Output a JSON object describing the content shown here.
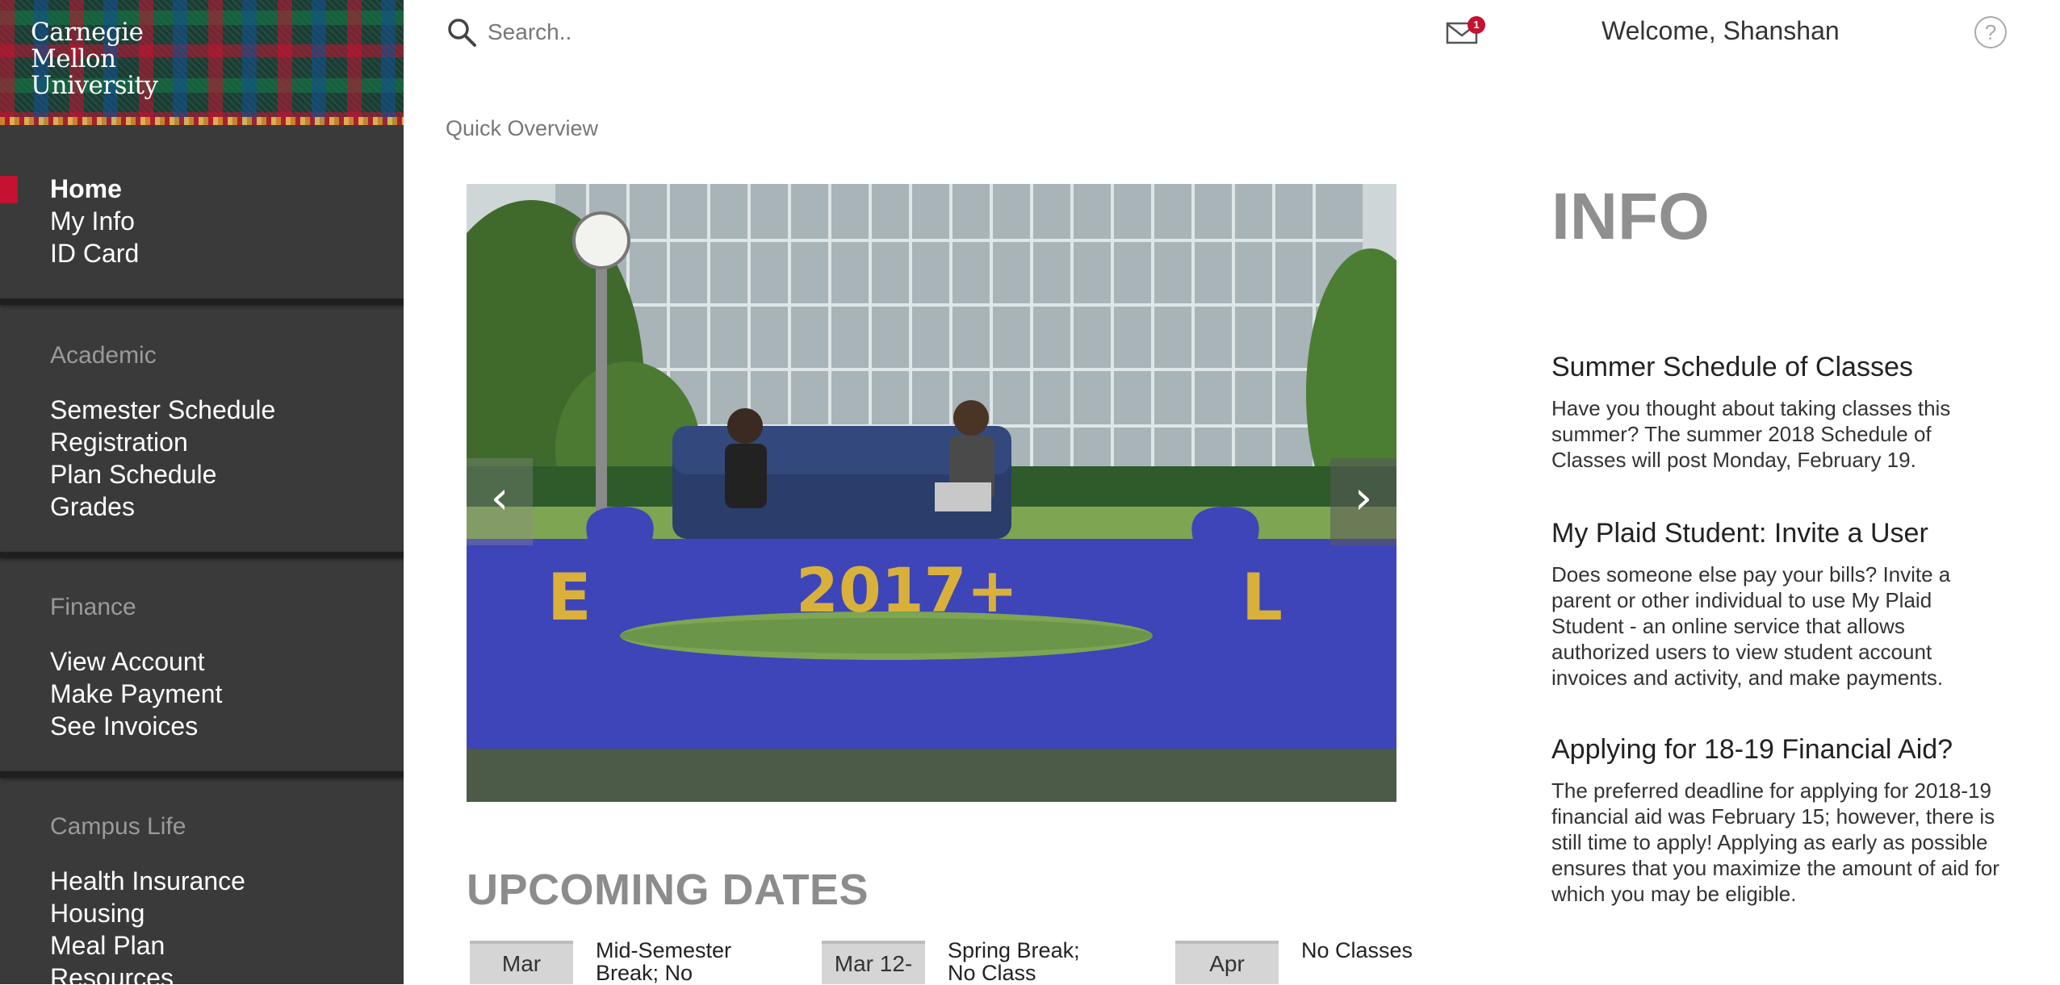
{
  "logo": {
    "line1": "Carnegie",
    "line2": "Mellon",
    "line3": "University"
  },
  "sidebar": {
    "main_items": [
      {
        "label": "Home"
      },
      {
        "label": "My Info"
      },
      {
        "label": "ID Card"
      }
    ],
    "sections": [
      {
        "heading": "Academic",
        "items": [
          {
            "label": "Semester Schedule"
          },
          {
            "label": "Registration"
          },
          {
            "label": "Plan Schedule"
          },
          {
            "label": "Grades"
          }
        ]
      },
      {
        "heading": "Finance",
        "items": [
          {
            "label": "View Account"
          },
          {
            "label": "Make Payment"
          },
          {
            "label": "See Invoices"
          }
        ]
      },
      {
        "heading": "Campus Life",
        "items": [
          {
            "label": "Health Insurance"
          },
          {
            "label": "Housing"
          },
          {
            "label": "Meal Plan"
          },
          {
            "label": "Resources"
          }
        ]
      }
    ]
  },
  "header": {
    "search_placeholder": "Search..",
    "mail_badge_count": "1",
    "welcome": "Welcome, Shanshan",
    "help_symbol": "?"
  },
  "breadcrumb": "Quick Overview",
  "carousel": {
    "banner_text": "2017+",
    "left_letter": "E",
    "right_letter": "L",
    "prev_symbol": "‹",
    "next_symbol": "›"
  },
  "upcoming": {
    "title": "UPCOMING DATES",
    "dates": [
      {
        "tab": "Mar",
        "text_line1": "Mid-Semester",
        "text_line2": "Break; No"
      },
      {
        "tab": "Mar 12-",
        "text_line1": "Spring Break;",
        "text_line2": "No Class"
      },
      {
        "tab": "Apr",
        "text_line1": "No Classes",
        "text_line2": ""
      }
    ]
  },
  "info": {
    "title": "INFO",
    "items": [
      {
        "heading": "Summer Schedule of Classes",
        "body": "Have you thought about taking classes this summer? The summer 2018 Schedule of Classes will post Monday, February 19."
      },
      {
        "heading": "My Plaid Student: Invite a User",
        "body": "Does someone else pay your bills? Invite a parent or other individual to use My Plaid Student - an online service that allows authorized users to view student account invoices and activity, and make payments."
      },
      {
        "heading": "Applying for 18-19 Financial Aid?",
        "body": "The preferred deadline for applying for 2018-19 financial aid was February 15; however, there is still time to apply! Applying as early as possible ensures that you maximize the amount of aid for which you may be eligible."
      }
    ]
  },
  "colors": {
    "accent": "#c41230",
    "sidebar_bg": "#3a3a3a",
    "heading_gray": "#8c8c8c"
  }
}
